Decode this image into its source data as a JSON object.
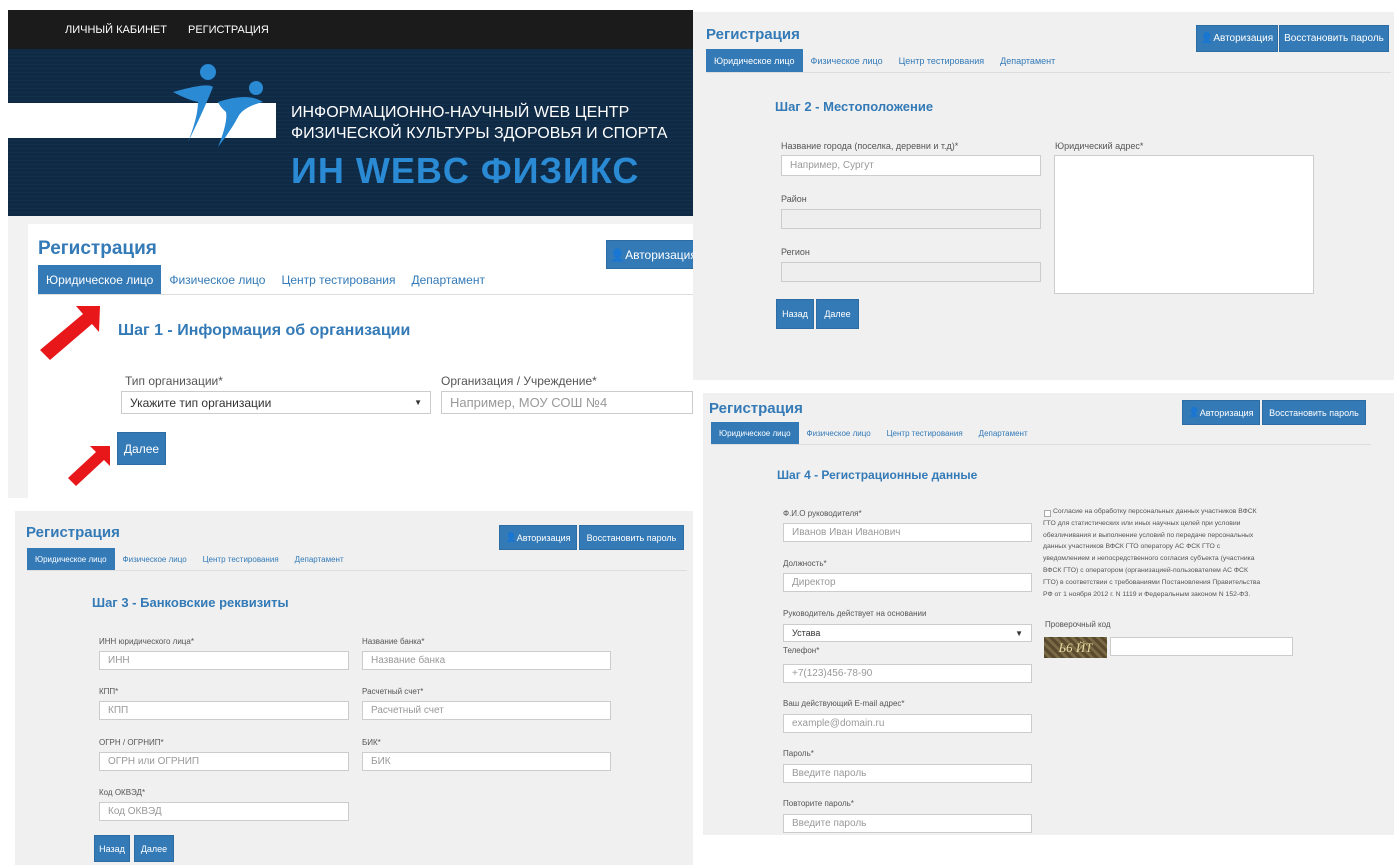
{
  "colors": {
    "accent": "#337ab7",
    "banner_bg": "#0f2a45",
    "nav_bg": "#1b1b1b",
    "arrow": "#e8171a"
  },
  "nav": {
    "items": [
      "ЛИЧНЫЙ КАБИНЕТ",
      "РЕГИСТРАЦИЯ"
    ]
  },
  "banner": {
    "line1": "ИНФОРМАЦИОННО-НАУЧНЫЙ WEB ЦЕНТР",
    "line2": "ФИЗИЧЕСКОЙ КУЛЬТУРЫ ЗДОРОВЬЯ И СПОРТА",
    "brand": "ИН WEBC ФИЗИКС"
  },
  "common": {
    "title": "Регистрация",
    "auth_button": "Авторизация",
    "restore_button": "Восстановить пароль",
    "back_button": "Назад",
    "next_button": "Далее",
    "tabs": [
      "Юридическое лицо",
      "Физическое лицо",
      "Центр тестирования",
      "Департамент"
    ]
  },
  "step1": {
    "prefix": "Шаг 1",
    "title": "Информация об организации",
    "org_type_label": "Тип организации*",
    "org_type_value": "Укажите тип организации",
    "org_label": "Организация / Учреждение*",
    "org_placeholder": "Например, МОУ СОШ №4"
  },
  "step2": {
    "prefix": "Шаг 2",
    "title": "Местоположение",
    "city_label": "Название города (поселка, деревни и т.д)*",
    "city_placeholder": "Например, Сургут",
    "district_label": "Район",
    "region_label": "Регион",
    "address_label": "Юридический адрес*"
  },
  "step3": {
    "prefix": "Шаг 3",
    "title": "Банковские реквизиты",
    "inn_label": "ИНН юридического лица*",
    "inn_placeholder": "ИНН",
    "bank_label": "Название банка*",
    "bank_placeholder": "Название банка",
    "kpp_label": "КПП*",
    "kpp_placeholder": "КПП",
    "account_label": "Расчетный счет*",
    "account_placeholder": "Расчетный счет",
    "ogrn_label": "ОГРН / ОГРНИП*",
    "ogrn_placeholder": "ОГРН или ОГРНИП",
    "bik_label": "БИК*",
    "bik_placeholder": "БИК",
    "okved_label": "Код ОКВЭД*",
    "okved_placeholder": "Код ОКВЭД"
  },
  "step4": {
    "prefix": "Шаг 4",
    "title": "Регистрационные данные",
    "fio_label": "Ф.И.О руководителя*",
    "fio_placeholder": "Иванов Иван Иванович",
    "position_label": "Должность*",
    "position_placeholder": "Директор",
    "basis_label": "Руководитель действует на основании",
    "basis_value": "Устава",
    "phone_label": "Телефон*",
    "phone_placeholder": "+7(123)456-78-90",
    "email_label": "Ваш действующий E-mail адрес*",
    "email_placeholder": "example@domain.ru",
    "password_label": "Пароль*",
    "password_placeholder": "Введите пароль",
    "password2_label": "Повторите пароль*",
    "password2_placeholder": "Введите пароль",
    "consent_lines": [
      "Согласие на обработку персональных данных участников ВФСК",
      "ГТО для статистических или иных научных целей при условии",
      "обезличивания и выполнение условий по передаче персональных",
      "данных участников ВФСК ГТО оператору АС ФСК ГТО с",
      "уведомлением и непосредственного согласия субъекта (участника",
      "ВФСК ГТО) с оператором (организацией-пользователем АС ФСК",
      "ГТО) в соответствии с требованиями Постановления Правительства",
      "РФ от 1 ноября 2012 г. N 1119 и Федеральным законом N 152-ФЗ."
    ],
    "captcha_label": "Проверочный код",
    "captcha_text": "Ь6 ЙТ"
  }
}
